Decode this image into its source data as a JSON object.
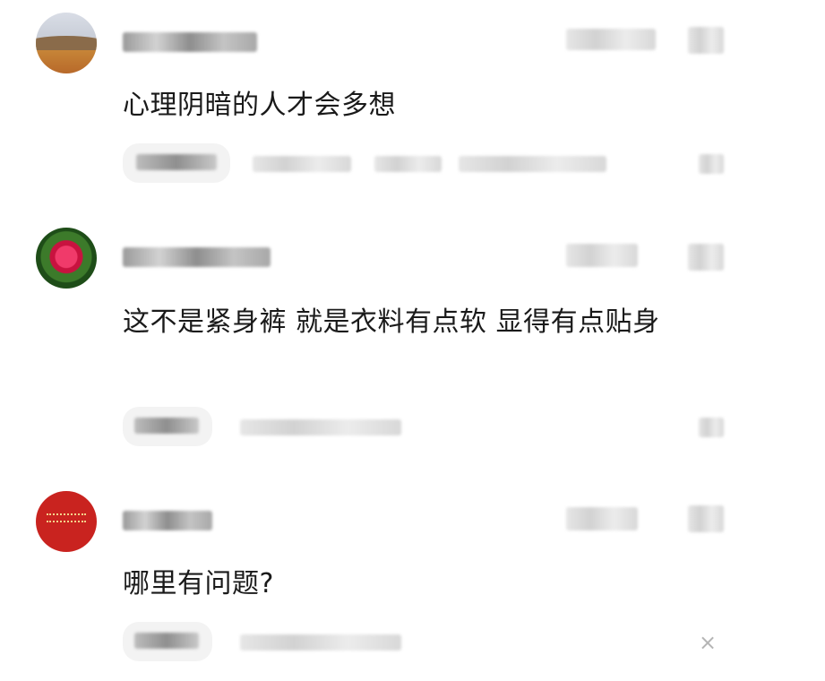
{
  "comments": [
    {
      "text": "心理阴暗的人才会多想",
      "avatar": "landscape-avatar"
    },
    {
      "text": "这不是紧身裤 就是衣料有点软 显得有点贴身",
      "avatar": "flower-avatar"
    },
    {
      "text": "哪里有问题?",
      "avatar": "red-card-avatar"
    }
  ],
  "icons": {
    "close": "×"
  }
}
